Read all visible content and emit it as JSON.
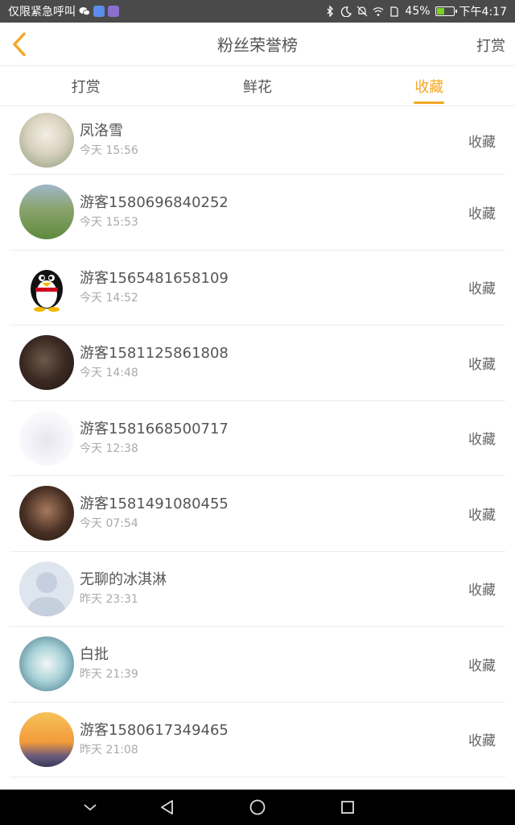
{
  "status_bar": {
    "left_text": "仅限紧急呼叫",
    "battery": "45%",
    "battery_level": 0.45,
    "time": "下午4:17"
  },
  "header": {
    "title": "粉丝荣誉榜",
    "action_label": "打赏"
  },
  "tabs": [
    {
      "label": "打赏",
      "active": false
    },
    {
      "label": "鲜花",
      "active": false
    },
    {
      "label": "收藏",
      "active": true
    }
  ],
  "list": [
    {
      "name": "凤洛雪",
      "time": "今天 15:56",
      "action": "收藏"
    },
    {
      "name": "游客1580696840252",
      "time": "今天 15:53",
      "action": "收藏"
    },
    {
      "name": "游客1565481658109",
      "time": "今天 14:52",
      "action": "收藏"
    },
    {
      "name": "游客1581125861808",
      "time": "今天 14:48",
      "action": "收藏"
    },
    {
      "name": "游客1581668500717",
      "time": "今天 12:38",
      "action": "收藏"
    },
    {
      "name": "游客1581491080455",
      "time": "今天 07:54",
      "action": "收藏"
    },
    {
      "name": "无聊的冰淇淋",
      "time": "昨天 23:31",
      "action": "收藏"
    },
    {
      "name": "白批",
      "time": "昨天 21:39",
      "action": "收藏"
    },
    {
      "name": "游客1580617349465",
      "time": "昨天 21:08",
      "action": "收藏"
    }
  ],
  "colors": {
    "accent": "#f5a623",
    "status_bar": "#4a4a4a",
    "nav_bar": "#000000"
  },
  "icons": [
    "back-chevron-icon",
    "bluetooth-icon",
    "moon-icon",
    "mute-icon",
    "wifi-icon",
    "battery-icon",
    "nav-down-icon",
    "nav-back-icon",
    "nav-home-icon",
    "nav-recent-icon"
  ]
}
